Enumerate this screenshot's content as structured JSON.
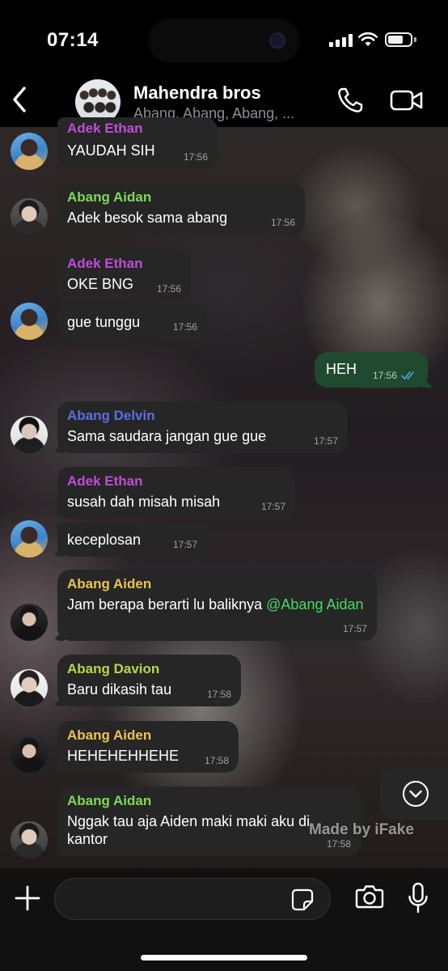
{
  "status_bar": {
    "time": "07:14",
    "battery_level": 0.7
  },
  "header": {
    "back_icon": "chevron-left-icon",
    "title": "Mahendra bros",
    "subtitle": "Abang, Abang, Abang, ...",
    "call_icon": "phone-icon",
    "video_icon": "video-camera-icon"
  },
  "colors": {
    "incoming_bubble": "#262626",
    "outgoing_bubble": "#1f4a30",
    "ethan": "#c04cd6",
    "aidan": "#7ed957",
    "delvin": "#5b6ee1",
    "aiden": "#e8c452",
    "davion": "#b6d84a",
    "mention": "#4cd964",
    "read_ticks": "#4fa3e8"
  },
  "messages": [
    {
      "sender": "Adek Ethan",
      "text": "YAUDAH SIH",
      "time": "17:56"
    },
    {
      "sender": "Abang Aidan",
      "text": "Adek besok sama abang",
      "time": "17:56"
    },
    {
      "sender": "Adek Ethan",
      "text": "OKE BNG",
      "time": "17:56"
    },
    {
      "sender": "",
      "text": "gue tunggu",
      "time": "17:56"
    },
    {
      "sender": "",
      "text": "HEH",
      "time": "17:56",
      "outgoing": true
    },
    {
      "sender": "Abang Delvin",
      "text": "Sama saudara jangan gue gue",
      "time": "17:57"
    },
    {
      "sender": "Adek Ethan",
      "text": "susah dah misah misah",
      "time": "17:57"
    },
    {
      "sender": "",
      "text": "keceplosan",
      "time": "17:57"
    },
    {
      "sender": "Abang Aiden",
      "text": "Jam berapa berarti lu baliknya ",
      "mention": "@Abang Aidan",
      "time": "17:57"
    },
    {
      "sender": "Abang Davion",
      "text": "Baru dikasih tau",
      "time": "17:58"
    },
    {
      "sender": "Abang Aiden",
      "text": "HEHEHEHHEHE",
      "time": "17:58"
    },
    {
      "sender": "Abang Aidan",
      "text": "Nggak tau aja Aiden maki maki aku di kantor",
      "time": "17:58"
    }
  ],
  "watermark": "Made by iFake",
  "input": {
    "placeholder": "",
    "value": ""
  },
  "input_icons": [
    "plus-icon",
    "sticker-icon",
    "camera-icon",
    "microphone-icon"
  ]
}
